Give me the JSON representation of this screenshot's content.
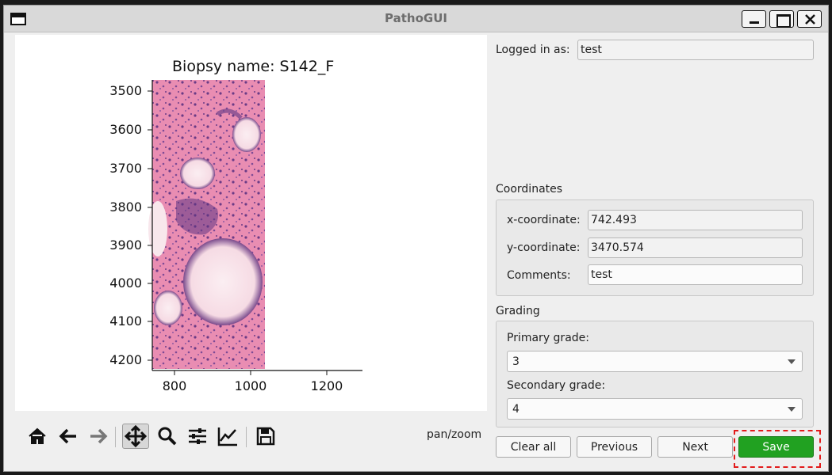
{
  "window": {
    "title": "PathoGUI"
  },
  "plot": {
    "title": "Biopsy name: S142_F",
    "yticks": [
      "3500",
      "3600",
      "3700",
      "3800",
      "3900",
      "4000",
      "4100",
      "4200"
    ],
    "xticks": [
      "800",
      "1000",
      "1200"
    ]
  },
  "toolbar": {
    "items": [
      "home-icon",
      "back-arrow-icon",
      "forward-arrow-icon",
      "pan-icon",
      "zoom-icon",
      "configure-subplots-icon",
      "edit-axis-icon",
      "save-figure-icon"
    ],
    "mode": "pan/zoom"
  },
  "login": {
    "label": "Logged in as:",
    "value": "test"
  },
  "coordinates": {
    "heading": "Coordinates",
    "x_label": "x-coordinate:",
    "x_value": "742.493",
    "y_label": "y-coordinate:",
    "y_value": "3470.574",
    "comments_label": "Comments:",
    "comments_value": "test"
  },
  "grading": {
    "heading": "Grading",
    "primary_label": "Primary grade:",
    "primary_value": "3",
    "secondary_label": "Secondary grade:",
    "secondary_value": "4"
  },
  "buttons": {
    "clear_all": "Clear all",
    "previous": "Previous",
    "next": "Next",
    "save": "Save"
  },
  "colors": {
    "save_button": "#21a121",
    "highlight_border": "#e21b1b"
  }
}
